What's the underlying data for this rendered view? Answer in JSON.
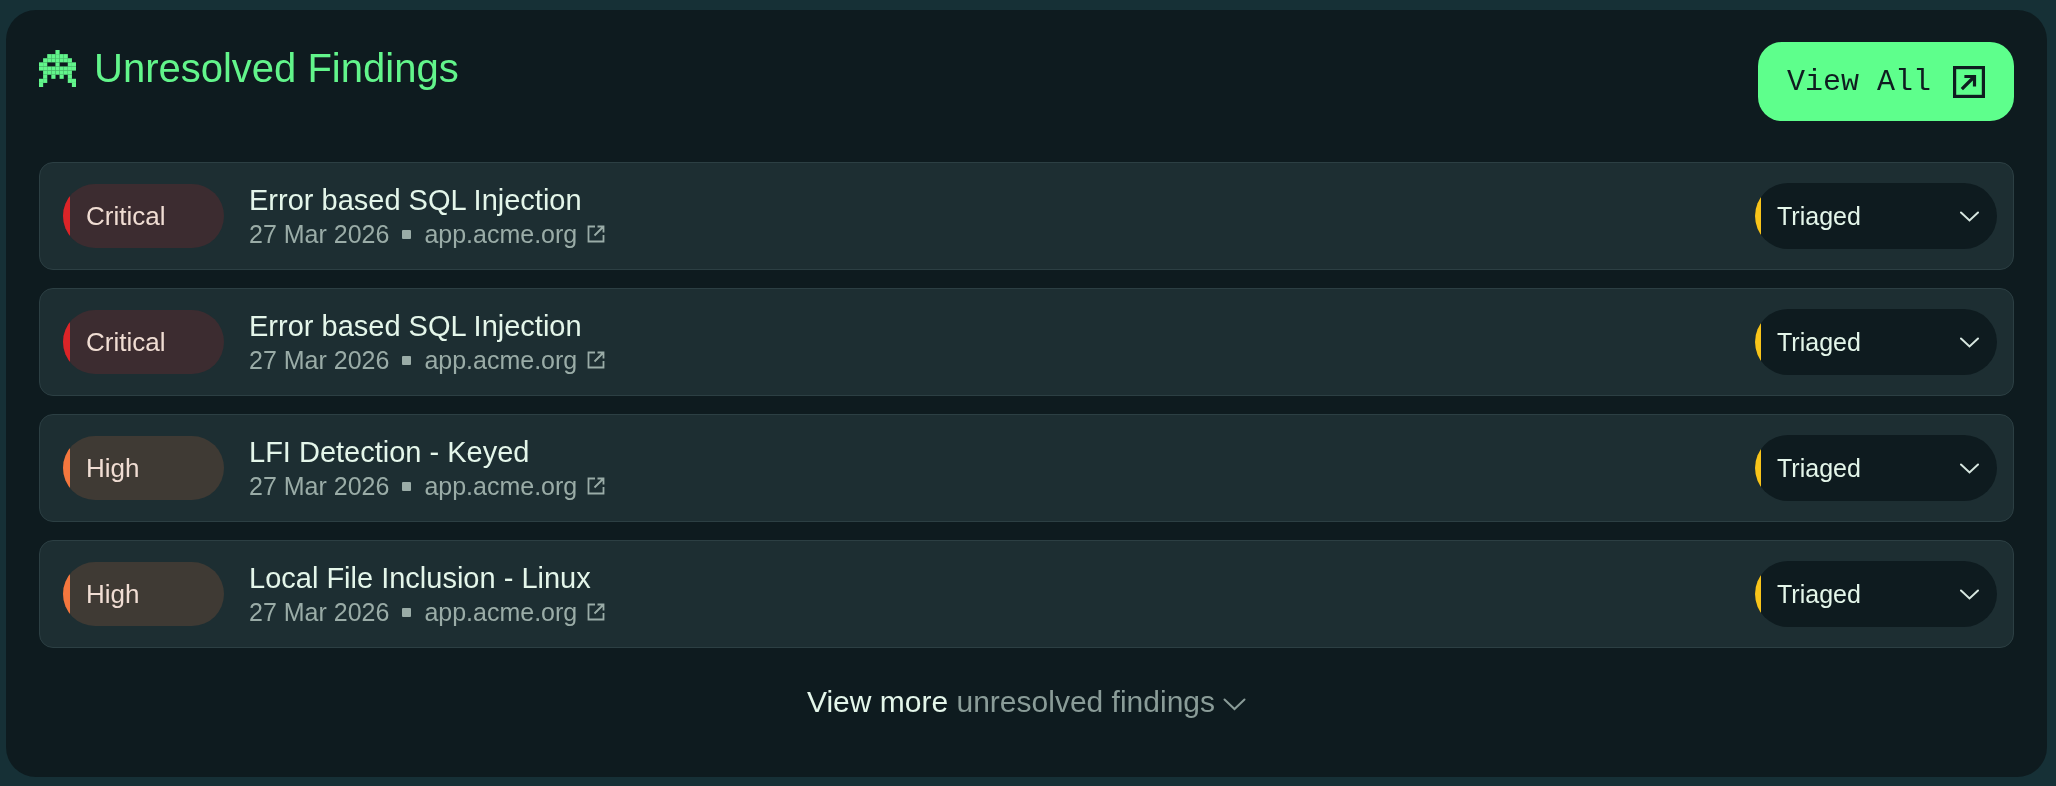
{
  "header": {
    "title": "Unresolved Findings",
    "action": {
      "label": "View All"
    }
  },
  "findings": [
    {
      "severity": {
        "label": "Critical",
        "color": "#dc2428"
      },
      "title": "Error based SQL Injection",
      "date": "27 Mar 2026",
      "host": "app.acme.org",
      "status": {
        "label": "Triaged",
        "color": "#f8c41a"
      }
    },
    {
      "severity": {
        "label": "Critical",
        "color": "#dc2428"
      },
      "title": "Error based SQL Injection",
      "date": "27 Mar 2026",
      "host": "app.acme.org",
      "status": {
        "label": "Triaged",
        "color": "#f8c41a"
      }
    },
    {
      "severity": {
        "label": "High",
        "color": "#f4773e"
      },
      "title": "LFI Detection - Keyed",
      "date": "27 Mar 2026",
      "host": "app.acme.org",
      "status": {
        "label": "Triaged",
        "color": "#f8c41a"
      }
    },
    {
      "severity": {
        "label": "High",
        "color": "#f4773e"
      },
      "title": "Local File Inclusion - Linux",
      "date": "27 Mar 2026",
      "host": "app.acme.org",
      "status": {
        "label": "Triaged",
        "color": "#f8c41a"
      }
    }
  ],
  "view_more": {
    "label": "View more",
    "detail": "unresolved findings"
  }
}
